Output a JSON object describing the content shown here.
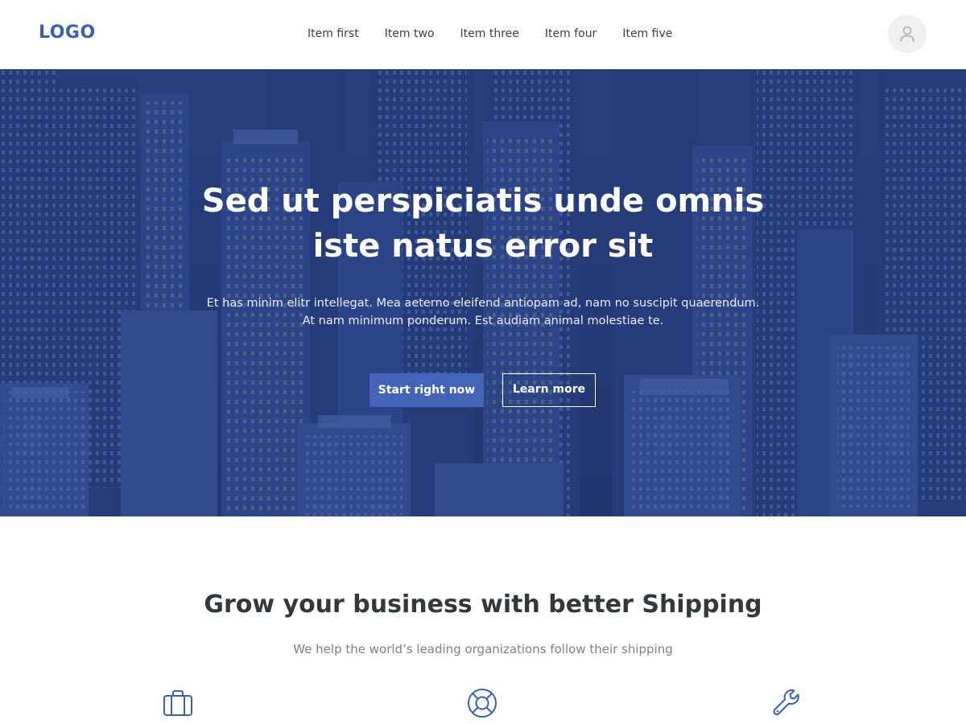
{
  "header": {
    "logo": "LOGO",
    "nav": [
      "Item first",
      "Item two",
      "Item three",
      "Item four",
      "Item five"
    ],
    "avatar_icon": "user-icon"
  },
  "hero": {
    "title_line1": "Sed ut perspiciatis unde omnis",
    "title_line2": "iste natus error sit",
    "subtitle_line1": "Et has minim elitr intellegat. Mea aeterno eleifend antiopam ad, nam no suscipit quaerendum.",
    "subtitle_line2": "At nam minimum ponderum. Est audiam animal molestiae te.",
    "primary_button": "Start right now",
    "secondary_button": "Learn more",
    "background": "city-skyline-photo"
  },
  "features": {
    "title": "Grow your business with better Shipping",
    "subtitle": "We help the world’s leading organizations follow their shipping",
    "icons": [
      "briefcase-icon",
      "lifebuoy-icon",
      "wrench-icon"
    ]
  },
  "colors": {
    "accent": "#3a5fb6",
    "primary_button": "#4464b8",
    "hero_overlay": "#2c4a96"
  }
}
